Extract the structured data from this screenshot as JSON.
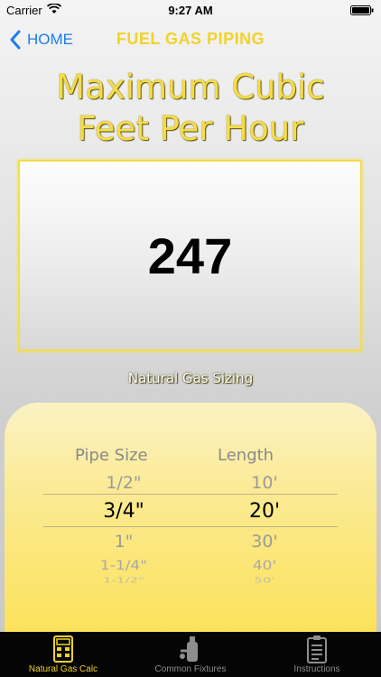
{
  "status": {
    "carrier": "Carrier",
    "time": "9:27 AM"
  },
  "nav": {
    "back_label": "HOME",
    "title": "FUEL GAS PIPING"
  },
  "heading": {
    "line1": "Maximum Cubic",
    "line2": "Feet Per Hour"
  },
  "result": {
    "value": "247"
  },
  "sizing_label": "Natural Gas Sizing",
  "picker": {
    "pipe_header": "Pipe Size",
    "length_header": "Length",
    "pipe_sizes": [
      "1/2\"",
      "3/4\"",
      "1\"",
      "1-1/4\"",
      "1-1/2\""
    ],
    "lengths": [
      "10'",
      "20'",
      "30'",
      "40'",
      "50'"
    ],
    "selected_pipe": "3/4\"",
    "selected_length": "20'"
  },
  "tabs": [
    {
      "label": "Natural Gas Calc",
      "icon": "calculator-icon",
      "active": true
    },
    {
      "label": "Common Fixtures",
      "icon": "fixtures-icon",
      "active": false
    },
    {
      "label": "Instructions",
      "icon": "clipboard-icon",
      "active": false
    }
  ],
  "colors": {
    "accent": "#f1d22a",
    "link": "#1a7cf5",
    "tab_active": "#f1d22a",
    "tab_inactive": "#8e8e8e"
  }
}
